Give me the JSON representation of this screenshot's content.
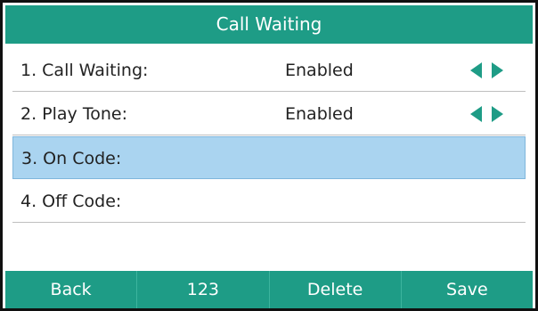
{
  "screen": {
    "title": "Call Waiting"
  },
  "rows": [
    {
      "label": "1. Call Waiting:",
      "value": "Enabled",
      "has_arrows": true,
      "selected": false
    },
    {
      "label": "2. Play Tone:",
      "value": "Enabled",
      "has_arrows": true,
      "selected": false
    },
    {
      "label": "3. On Code:",
      "value": "",
      "has_arrows": false,
      "selected": true
    },
    {
      "label": "4. Off Code:",
      "value": "",
      "has_arrows": false,
      "selected": false
    }
  ],
  "softkeys": [
    {
      "label": "Back"
    },
    {
      "label": "123"
    },
    {
      "label": "Delete"
    },
    {
      "label": "Save"
    }
  ],
  "icons": {
    "arrow_left": "arrow-left-icon",
    "arrow_right": "arrow-right-icon"
  },
  "colors": {
    "accent": "#1e9c86",
    "selected_row": "#aad4f0"
  }
}
